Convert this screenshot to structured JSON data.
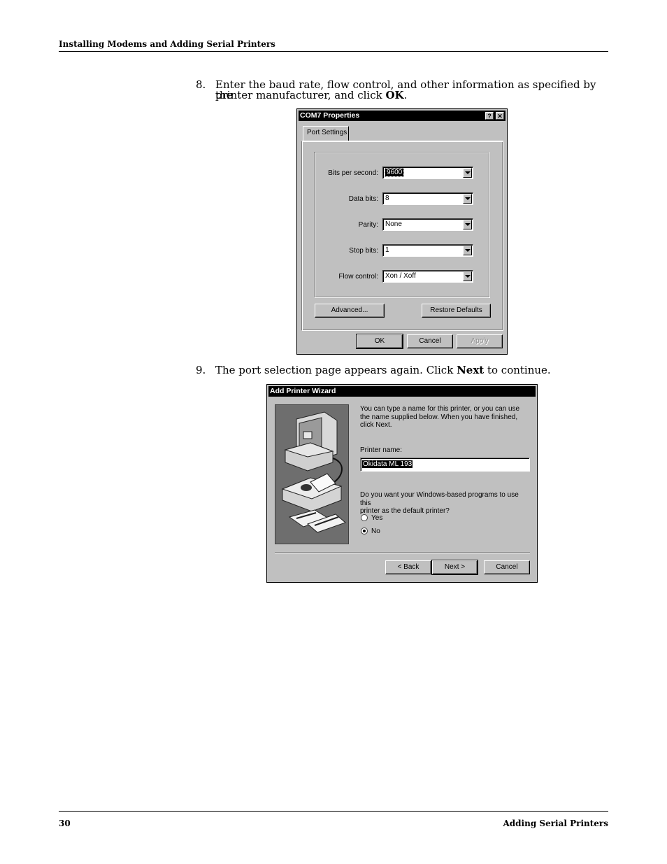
{
  "header": {
    "title": "Installing Modems and Adding Serial Printers"
  },
  "steps": [
    {
      "number": "8.",
      "line1": "Enter the baud rate, flow control, and other information as specified by the",
      "line2_pre": "printer manufacturer, and click ",
      "line2_bold": "OK",
      "line2_post": "."
    },
    {
      "number": "9.",
      "text_pre": "The port selection page appears again. Click ",
      "text_bold": "Next",
      "text_post": " to continue."
    }
  ],
  "com_dialog": {
    "title": "COM7 Properties",
    "help_btn": "?",
    "close_btn": "✕",
    "tab": "Port Settings",
    "fields": [
      {
        "label": "Bits per second:",
        "value": "9600"
      },
      {
        "label": "Data bits:",
        "value": "8"
      },
      {
        "label": "Parity:",
        "value": "None"
      },
      {
        "label": "Stop bits:",
        "value": "1"
      },
      {
        "label": "Flow control:",
        "value": "Xon / Xoff"
      }
    ],
    "advanced": "Advanced...",
    "restore": "Restore Defaults",
    "ok": "OK",
    "cancel": "Cancel",
    "apply": "Apply"
  },
  "wizard": {
    "title": "Add Printer Wizard",
    "intro": [
      "You can type a name for this printer, or you can use",
      "the name supplied below. When you have finished,",
      "click Next."
    ],
    "printer_name_label": "Printer name:",
    "printer_name_value": "Okidata ML 193",
    "default_q": [
      "Do you want your Windows-based programs to use this",
      "printer as the default printer?"
    ],
    "yes": "Yes",
    "no": "No",
    "back": "< Back",
    "next": "Next >",
    "cancel": "Cancel",
    "image": "computer-printer-illustration"
  },
  "footer": {
    "page_number": "30",
    "section": "Adding Serial Printers"
  }
}
